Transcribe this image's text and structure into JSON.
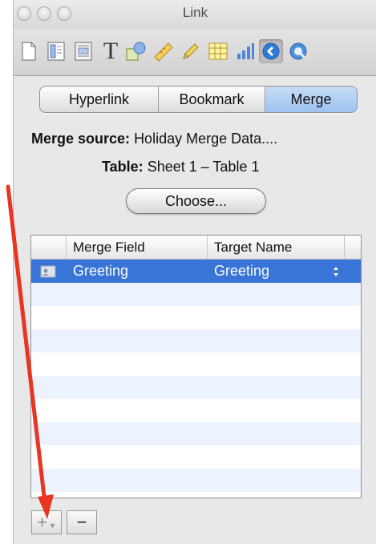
{
  "window": {
    "title": "Link"
  },
  "toolbar": {
    "icons": [
      "document-icon",
      "layout-icon",
      "wrap-icon",
      "text-icon",
      "shapes-icon",
      "ruler-icon",
      "pencil-icon",
      "table-icon",
      "chart-icon",
      "link-icon",
      "quicktime-icon"
    ]
  },
  "tabs": [
    "Hyperlink",
    "Bookmark",
    "Merge"
  ],
  "selected_tab": "Merge",
  "merge": {
    "source_label": "Merge source:",
    "source_value": "Holiday Merge Data....",
    "table_label": "Table:",
    "table_value": "Sheet 1 – Table 1",
    "choose_button": "Choose..."
  },
  "fields_table": {
    "columns": [
      "Merge Field",
      "Target Name"
    ],
    "rows": [
      {
        "merge_field": "Greeting",
        "target_name": "Greeting",
        "selected": true
      }
    ]
  },
  "controls": {
    "add_label": "+",
    "remove_label": "−"
  },
  "colors": {
    "selection": "#3875d7",
    "alt_row": "#edf3fe",
    "annotation_arrow": "#e8351f"
  }
}
